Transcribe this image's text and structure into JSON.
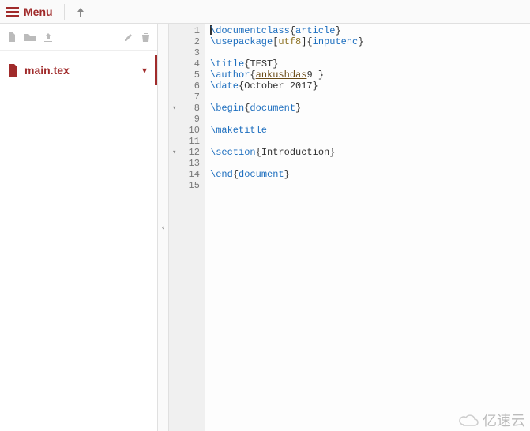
{
  "topbar": {
    "menu_label": "Menu"
  },
  "sidebar": {
    "file": {
      "name": "main.tex"
    }
  },
  "editor": {
    "lines": [
      {
        "n": 1,
        "fold": "",
        "tokens": [
          {
            "t": "cmd",
            "v": "\\documentclass"
          },
          {
            "t": "plain",
            "v": "{"
          },
          {
            "t": "key",
            "v": "article"
          },
          {
            "t": "plain",
            "v": "}"
          }
        ],
        "cursor_at": 0
      },
      {
        "n": 2,
        "fold": "",
        "tokens": [
          {
            "t": "cmd",
            "v": "\\usepackage"
          },
          {
            "t": "plain",
            "v": "["
          },
          {
            "t": "special",
            "v": "utf8"
          },
          {
            "t": "plain",
            "v": "]{"
          },
          {
            "t": "key",
            "v": "inputenc"
          },
          {
            "t": "plain",
            "v": "}"
          }
        ]
      },
      {
        "n": 3,
        "fold": "",
        "tokens": []
      },
      {
        "n": 4,
        "fold": "",
        "tokens": [
          {
            "t": "cmd",
            "v": "\\title"
          },
          {
            "t": "plain",
            "v": "{"
          },
          {
            "t": "arg",
            "v": "TEST"
          },
          {
            "t": "plain",
            "v": "}"
          }
        ]
      },
      {
        "n": 5,
        "fold": "",
        "tokens": [
          {
            "t": "cmd",
            "v": "\\author"
          },
          {
            "t": "plain",
            "v": "{"
          },
          {
            "t": "author",
            "v": "ankushdas"
          },
          {
            "t": "arg",
            "v": "9 "
          },
          {
            "t": "plain",
            "v": "}"
          }
        ]
      },
      {
        "n": 6,
        "fold": "",
        "tokens": [
          {
            "t": "cmd",
            "v": "\\date"
          },
          {
            "t": "plain",
            "v": "{"
          },
          {
            "t": "arg",
            "v": "October 2017"
          },
          {
            "t": "plain",
            "v": "}"
          }
        ]
      },
      {
        "n": 7,
        "fold": "",
        "tokens": []
      },
      {
        "n": 8,
        "fold": "▾",
        "tokens": [
          {
            "t": "cmd",
            "v": "\\begin"
          },
          {
            "t": "plain",
            "v": "{"
          },
          {
            "t": "key",
            "v": "document"
          },
          {
            "t": "plain",
            "v": "}"
          }
        ]
      },
      {
        "n": 9,
        "fold": "",
        "tokens": []
      },
      {
        "n": 10,
        "fold": "",
        "tokens": [
          {
            "t": "cmd",
            "v": "\\maketitle"
          }
        ]
      },
      {
        "n": 11,
        "fold": "",
        "tokens": []
      },
      {
        "n": 12,
        "fold": "▾",
        "tokens": [
          {
            "t": "cmd",
            "v": "\\section"
          },
          {
            "t": "plain",
            "v": "{"
          },
          {
            "t": "arg",
            "v": "Introduction"
          },
          {
            "t": "plain",
            "v": "}"
          }
        ]
      },
      {
        "n": 13,
        "fold": "",
        "tokens": []
      },
      {
        "n": 14,
        "fold": "",
        "tokens": [
          {
            "t": "cmd",
            "v": "\\end"
          },
          {
            "t": "plain",
            "v": "{"
          },
          {
            "t": "key",
            "v": "document"
          },
          {
            "t": "plain",
            "v": "}"
          }
        ]
      },
      {
        "n": 15,
        "fold": "",
        "tokens": []
      }
    ]
  },
  "watermark": {
    "text": "亿速云"
  }
}
